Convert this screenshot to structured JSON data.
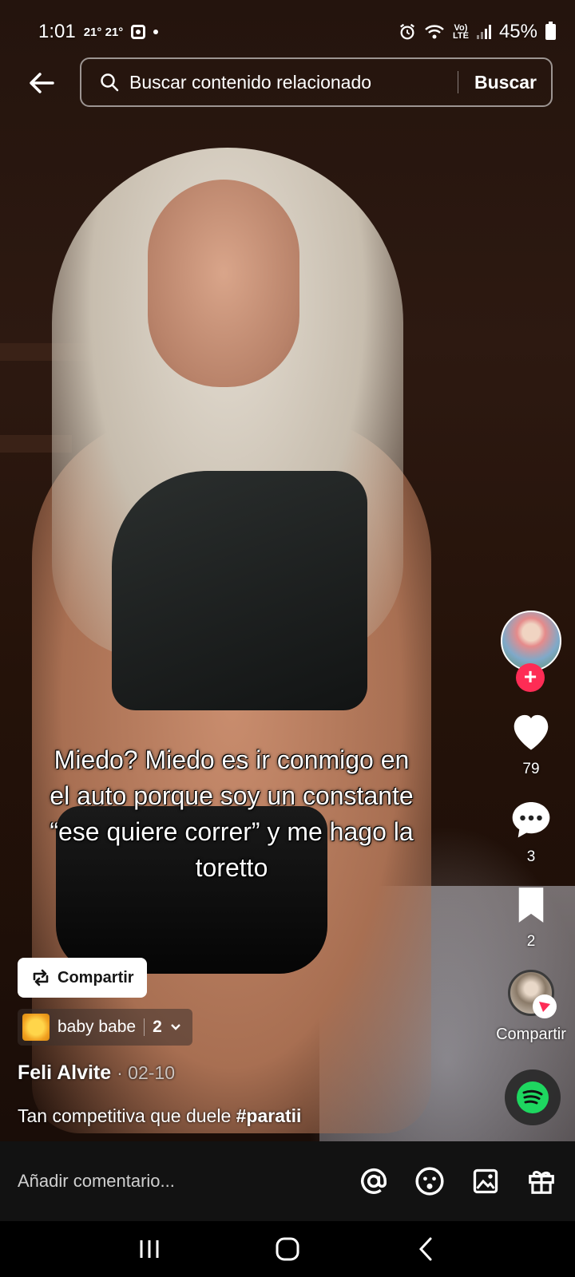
{
  "status_bar": {
    "time": "1:01",
    "temps": "21° 21°",
    "battery": "45%"
  },
  "header": {
    "search_placeholder": "Buscar contenido relacionado",
    "search_button": "Buscar"
  },
  "video": {
    "caption": "Miedo? Miedo es ir conmigo en el auto porque soy un constante “ese quiere correr” y me hago la toretto"
  },
  "rail": {
    "likes": "79",
    "comments": "3",
    "saves": "2",
    "share_label": "Compartir"
  },
  "info": {
    "repost_label": "Compartir",
    "playlist_name": "baby babe",
    "playlist_count": "2",
    "author": "Feli Alvite",
    "date": "· 02-10",
    "description": "Tan competitiva que duele ",
    "hashtag": "#paratii"
  },
  "comment_bar": {
    "placeholder": "Añadir comentario..."
  },
  "colors": {
    "accent": "#fe2c55",
    "spotify": "#1ed760"
  },
  "icons": [
    "back-arrow-icon",
    "search-icon",
    "heart-icon",
    "comment-icon",
    "bookmark-icon",
    "repost-icon",
    "chevron-down-icon",
    "mention-icon",
    "emoji-icon",
    "image-icon",
    "gift-icon",
    "spotify-icon",
    "recents-icon",
    "home-icon",
    "back-nav-icon"
  ]
}
